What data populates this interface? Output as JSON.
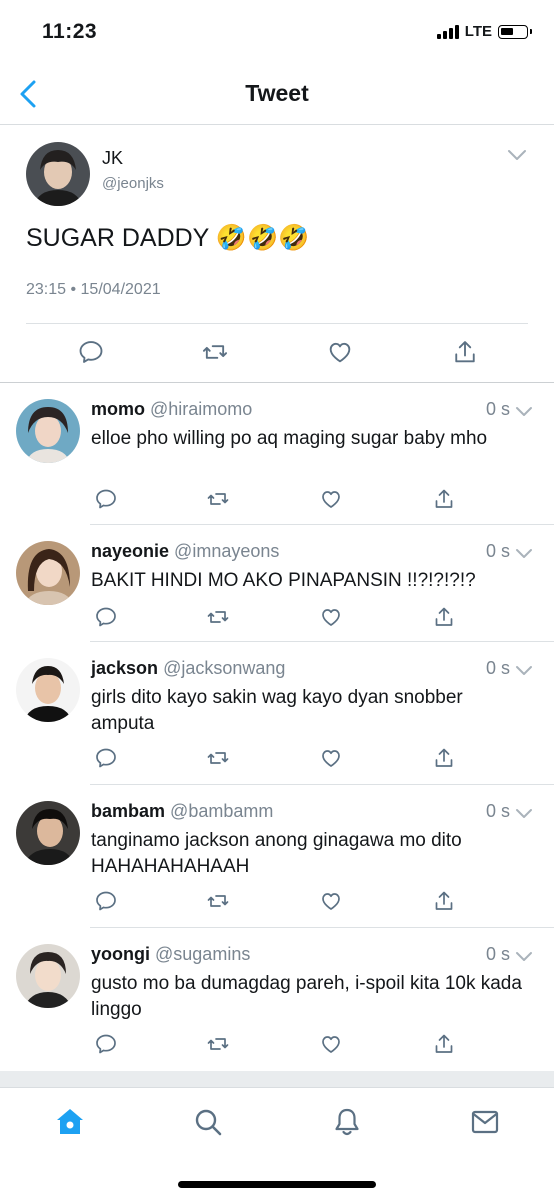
{
  "status": {
    "time": "11:23",
    "network": "LTE"
  },
  "nav": {
    "title": "Tweet",
    "back_icon": "chevron-left-icon"
  },
  "tweet": {
    "name": "JK",
    "handle": "@jeonjks",
    "text": "SUGAR DADDY 🤣🤣🤣",
    "timestamp": "23:15 • 15/04/2021"
  },
  "replies": [
    {
      "name": "momo",
      "handle": "@hiraimomo",
      "time": "0 s",
      "text": "elloe pho willing po aq maging sugar baby mho"
    },
    {
      "name": "nayeonie",
      "handle": "@imnayeons",
      "time": "0 s",
      "text": "BAKIT HINDI MO AKO PINAPANSIN !!?!?!?!?"
    },
    {
      "name": "jackson",
      "handle": "@jacksonwang",
      "time": "0 s",
      "text": "girls dito kayo sakin wag kayo dyan snobber amputa"
    },
    {
      "name": "bambam",
      "handle": "@bambamm",
      "time": "0 s",
      "text": "tanginamo jackson anong ginagawa mo dito HAHAHAHAHAAH"
    },
    {
      "name": "yoongi",
      "handle": "@sugamins",
      "time": "0 s",
      "text": "gusto mo ba dumagdag pareh, i-spoil kita 10k kada linggo"
    }
  ],
  "tabs": [
    "home-icon",
    "search-icon",
    "bell-icon",
    "mail-icon"
  ],
  "colors": {
    "accent": "#1da1f2",
    "icon_gray": "#5b7083",
    "muted_text": "#7a8590"
  }
}
